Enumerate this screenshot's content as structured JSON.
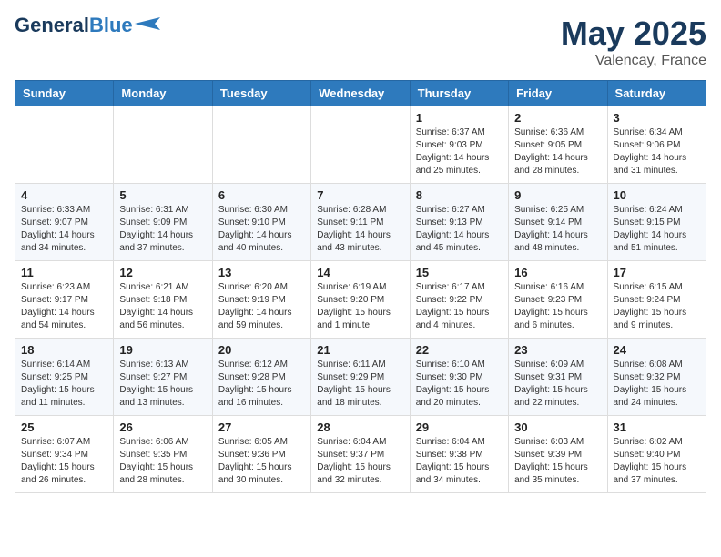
{
  "header": {
    "logo_general": "General",
    "logo_blue": "Blue",
    "month": "May 2025",
    "location": "Valencay, France"
  },
  "weekdays": [
    "Sunday",
    "Monday",
    "Tuesday",
    "Wednesday",
    "Thursday",
    "Friday",
    "Saturday"
  ],
  "weeks": [
    [
      {
        "day": "",
        "sunrise": "",
        "sunset": "",
        "daylight": ""
      },
      {
        "day": "",
        "sunrise": "",
        "sunset": "",
        "daylight": ""
      },
      {
        "day": "",
        "sunrise": "",
        "sunset": "",
        "daylight": ""
      },
      {
        "day": "",
        "sunrise": "",
        "sunset": "",
        "daylight": ""
      },
      {
        "day": "1",
        "sunrise": "Sunrise: 6:37 AM",
        "sunset": "Sunset: 9:03 PM",
        "daylight": "Daylight: 14 hours and 25 minutes."
      },
      {
        "day": "2",
        "sunrise": "Sunrise: 6:36 AM",
        "sunset": "Sunset: 9:05 PM",
        "daylight": "Daylight: 14 hours and 28 minutes."
      },
      {
        "day": "3",
        "sunrise": "Sunrise: 6:34 AM",
        "sunset": "Sunset: 9:06 PM",
        "daylight": "Daylight: 14 hours and 31 minutes."
      }
    ],
    [
      {
        "day": "4",
        "sunrise": "Sunrise: 6:33 AM",
        "sunset": "Sunset: 9:07 PM",
        "daylight": "Daylight: 14 hours and 34 minutes."
      },
      {
        "day": "5",
        "sunrise": "Sunrise: 6:31 AM",
        "sunset": "Sunset: 9:09 PM",
        "daylight": "Daylight: 14 hours and 37 minutes."
      },
      {
        "day": "6",
        "sunrise": "Sunrise: 6:30 AM",
        "sunset": "Sunset: 9:10 PM",
        "daylight": "Daylight: 14 hours and 40 minutes."
      },
      {
        "day": "7",
        "sunrise": "Sunrise: 6:28 AM",
        "sunset": "Sunset: 9:11 PM",
        "daylight": "Daylight: 14 hours and 43 minutes."
      },
      {
        "day": "8",
        "sunrise": "Sunrise: 6:27 AM",
        "sunset": "Sunset: 9:13 PM",
        "daylight": "Daylight: 14 hours and 45 minutes."
      },
      {
        "day": "9",
        "sunrise": "Sunrise: 6:25 AM",
        "sunset": "Sunset: 9:14 PM",
        "daylight": "Daylight: 14 hours and 48 minutes."
      },
      {
        "day": "10",
        "sunrise": "Sunrise: 6:24 AM",
        "sunset": "Sunset: 9:15 PM",
        "daylight": "Daylight: 14 hours and 51 minutes."
      }
    ],
    [
      {
        "day": "11",
        "sunrise": "Sunrise: 6:23 AM",
        "sunset": "Sunset: 9:17 PM",
        "daylight": "Daylight: 14 hours and 54 minutes."
      },
      {
        "day": "12",
        "sunrise": "Sunrise: 6:21 AM",
        "sunset": "Sunset: 9:18 PM",
        "daylight": "Daylight: 14 hours and 56 minutes."
      },
      {
        "day": "13",
        "sunrise": "Sunrise: 6:20 AM",
        "sunset": "Sunset: 9:19 PM",
        "daylight": "Daylight: 14 hours and 59 minutes."
      },
      {
        "day": "14",
        "sunrise": "Sunrise: 6:19 AM",
        "sunset": "Sunset: 9:20 PM",
        "daylight": "Daylight: 15 hours and 1 minute."
      },
      {
        "day": "15",
        "sunrise": "Sunrise: 6:17 AM",
        "sunset": "Sunset: 9:22 PM",
        "daylight": "Daylight: 15 hours and 4 minutes."
      },
      {
        "day": "16",
        "sunrise": "Sunrise: 6:16 AM",
        "sunset": "Sunset: 9:23 PM",
        "daylight": "Daylight: 15 hours and 6 minutes."
      },
      {
        "day": "17",
        "sunrise": "Sunrise: 6:15 AM",
        "sunset": "Sunset: 9:24 PM",
        "daylight": "Daylight: 15 hours and 9 minutes."
      }
    ],
    [
      {
        "day": "18",
        "sunrise": "Sunrise: 6:14 AM",
        "sunset": "Sunset: 9:25 PM",
        "daylight": "Daylight: 15 hours and 11 minutes."
      },
      {
        "day": "19",
        "sunrise": "Sunrise: 6:13 AM",
        "sunset": "Sunset: 9:27 PM",
        "daylight": "Daylight: 15 hours and 13 minutes."
      },
      {
        "day": "20",
        "sunrise": "Sunrise: 6:12 AM",
        "sunset": "Sunset: 9:28 PM",
        "daylight": "Daylight: 15 hours and 16 minutes."
      },
      {
        "day": "21",
        "sunrise": "Sunrise: 6:11 AM",
        "sunset": "Sunset: 9:29 PM",
        "daylight": "Daylight: 15 hours and 18 minutes."
      },
      {
        "day": "22",
        "sunrise": "Sunrise: 6:10 AM",
        "sunset": "Sunset: 9:30 PM",
        "daylight": "Daylight: 15 hours and 20 minutes."
      },
      {
        "day": "23",
        "sunrise": "Sunrise: 6:09 AM",
        "sunset": "Sunset: 9:31 PM",
        "daylight": "Daylight: 15 hours and 22 minutes."
      },
      {
        "day": "24",
        "sunrise": "Sunrise: 6:08 AM",
        "sunset": "Sunset: 9:32 PM",
        "daylight": "Daylight: 15 hours and 24 minutes."
      }
    ],
    [
      {
        "day": "25",
        "sunrise": "Sunrise: 6:07 AM",
        "sunset": "Sunset: 9:34 PM",
        "daylight": "Daylight: 15 hours and 26 minutes."
      },
      {
        "day": "26",
        "sunrise": "Sunrise: 6:06 AM",
        "sunset": "Sunset: 9:35 PM",
        "daylight": "Daylight: 15 hours and 28 minutes."
      },
      {
        "day": "27",
        "sunrise": "Sunrise: 6:05 AM",
        "sunset": "Sunset: 9:36 PM",
        "daylight": "Daylight: 15 hours and 30 minutes."
      },
      {
        "day": "28",
        "sunrise": "Sunrise: 6:04 AM",
        "sunset": "Sunset: 9:37 PM",
        "daylight": "Daylight: 15 hours and 32 minutes."
      },
      {
        "day": "29",
        "sunrise": "Sunrise: 6:04 AM",
        "sunset": "Sunset: 9:38 PM",
        "daylight": "Daylight: 15 hours and 34 minutes."
      },
      {
        "day": "30",
        "sunrise": "Sunrise: 6:03 AM",
        "sunset": "Sunset: 9:39 PM",
        "daylight": "Daylight: 15 hours and 35 minutes."
      },
      {
        "day": "31",
        "sunrise": "Sunrise: 6:02 AM",
        "sunset": "Sunset: 9:40 PM",
        "daylight": "Daylight: 15 hours and 37 minutes."
      }
    ]
  ]
}
